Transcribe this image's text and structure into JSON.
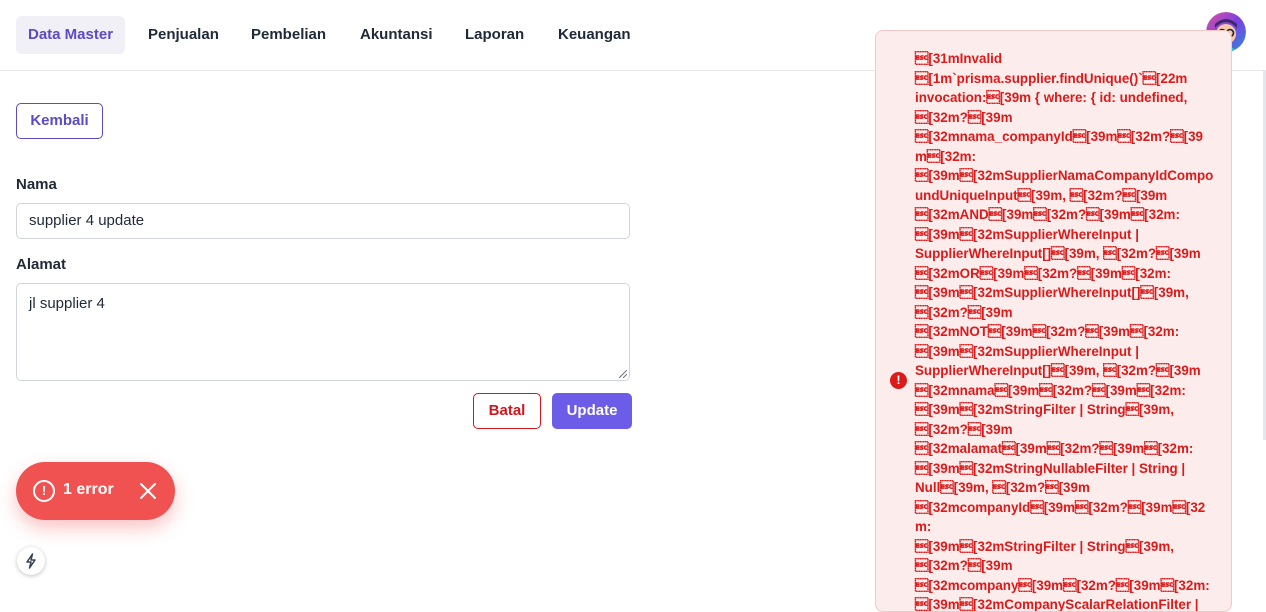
{
  "nav": {
    "items": [
      {
        "label": "Data Master",
        "active": true
      },
      {
        "label": "Penjualan"
      },
      {
        "label": "Pembelian"
      },
      {
        "label": "Akuntansi"
      },
      {
        "label": "Laporan"
      },
      {
        "label": "Keuangan"
      }
    ]
  },
  "form": {
    "back_label": "Kembali",
    "nama_label": "Nama",
    "nama_value": "supplier 4 update",
    "alamat_label": "Alamat",
    "alamat_value": "jl supplier 4",
    "batal_label": "Batal",
    "update_label": "Update"
  },
  "error_toast": {
    "label": "1 error",
    "icon": "alert-circle-icon"
  },
  "error_panel": {
    "message": "\u001b[31mInvalid\n\u001b[1m`prisma.supplier.findUnique()`\u001b[22m\ninvocation:\u001b[39m { where: { id: undefined,\n\u001b[32m?\u001b[39m\n\u001b[32mnama_companyId\u001b[39m\u001b[32m?\u001b[39m\u001b[32m:\n\u001b[39m\u001b[32mSupplierNamaCompanyIdCompoundUniqueInput\u001b[39m, \u001b[32m?\u001b[39m\n\u001b[32mAND\u001b[39m\u001b[32m?\u001b[39m\u001b[32m:\n\u001b[39m\u001b[32mSupplierWhereInput |\nSupplierWhereInput[]\u001b[39m, \u001b[32m?\u001b[39m\n\u001b[32mOR\u001b[39m\u001b[32m?\u001b[39m\u001b[32m:\n\u001b[39m\u001b[32mSupplierWhereInput[]\u001b[39m,\n\u001b[32m?\u001b[39m\n\u001b[32mNOT\u001b[39m\u001b[32m?\u001b[39m\u001b[32m:\n\u001b[39m\u001b[32mSupplierWhereInput |\nSupplierWhereInput[]\u001b[39m, \u001b[32m?\u001b[39m\n\u001b[32mnama\u001b[39m\u001b[32m?\u001b[39m\u001b[32m:\n\u001b[39m\u001b[32mStringFilter | String\u001b[39m,\n\u001b[32m?\u001b[39m\n\u001b[32malamat\u001b[39m\u001b[32m?\u001b[39m\u001b[32m:\n\u001b[39m\u001b[32mStringNullableFilter | String |\nNull\u001b[39m, \u001b[32m?\u001b[39m\n\u001b[32mcompanyId\u001b[39m\u001b[32m?\u001b[39m\u001b[32m:\n\u001b[39m\u001b[32mStringFilter | String\u001b[39m,\n\u001b[32m?\u001b[39m\n\u001b[32mcompany\u001b[39m\u001b[32m?\u001b[39m\u001b[32m:\n\u001b[39m\u001b[32mCompanyScalarRelationFilter |",
    "icon": "error-icon",
    "color": "#dc1a1a",
    "background": "#fdecec"
  },
  "colors": {
    "accent": "#6d5ce7",
    "danger": "#d0171e",
    "toast": "#f05252"
  }
}
